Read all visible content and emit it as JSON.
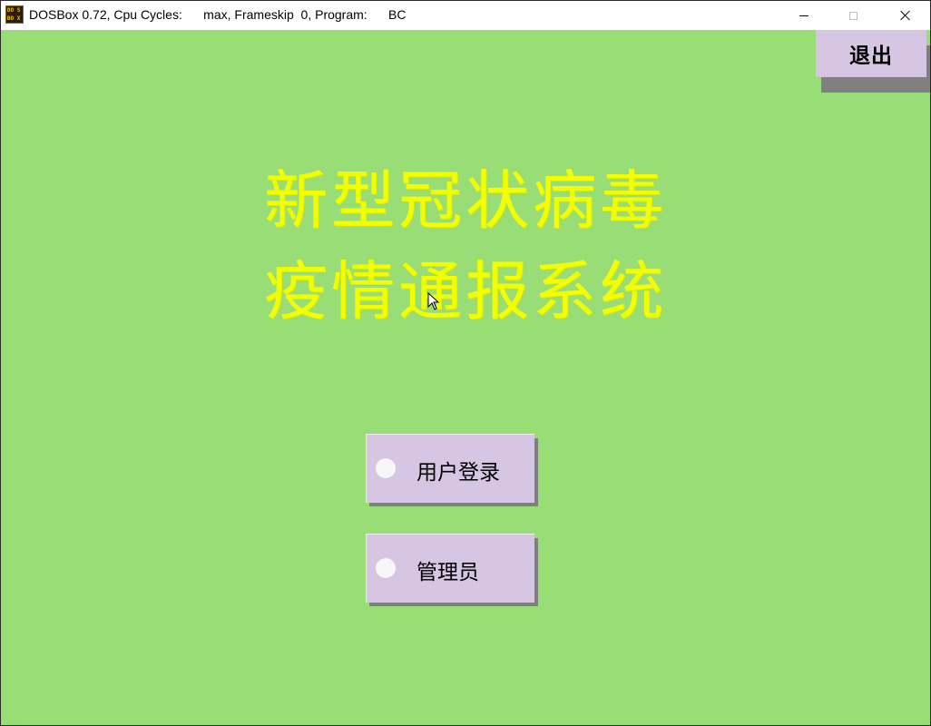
{
  "window": {
    "title": "DOSBox 0.72, Cpu Cycles:      max, Frameskip  0, Program:      BC",
    "icon_text": [
      "DO",
      "S",
      "BO",
      "X"
    ],
    "controls": [
      "minimize-icon",
      "maximize-icon",
      "close-icon"
    ]
  },
  "screen": {
    "background": "#99dd77",
    "exit_label": "退出",
    "title_line1": "新型冠状病毒",
    "title_line2": "疫情通报系统",
    "title_color": "#f2ff00",
    "menu": [
      {
        "label": "用户登录"
      },
      {
        "label": "管理员"
      }
    ],
    "button_color": "#d6c6e4"
  }
}
